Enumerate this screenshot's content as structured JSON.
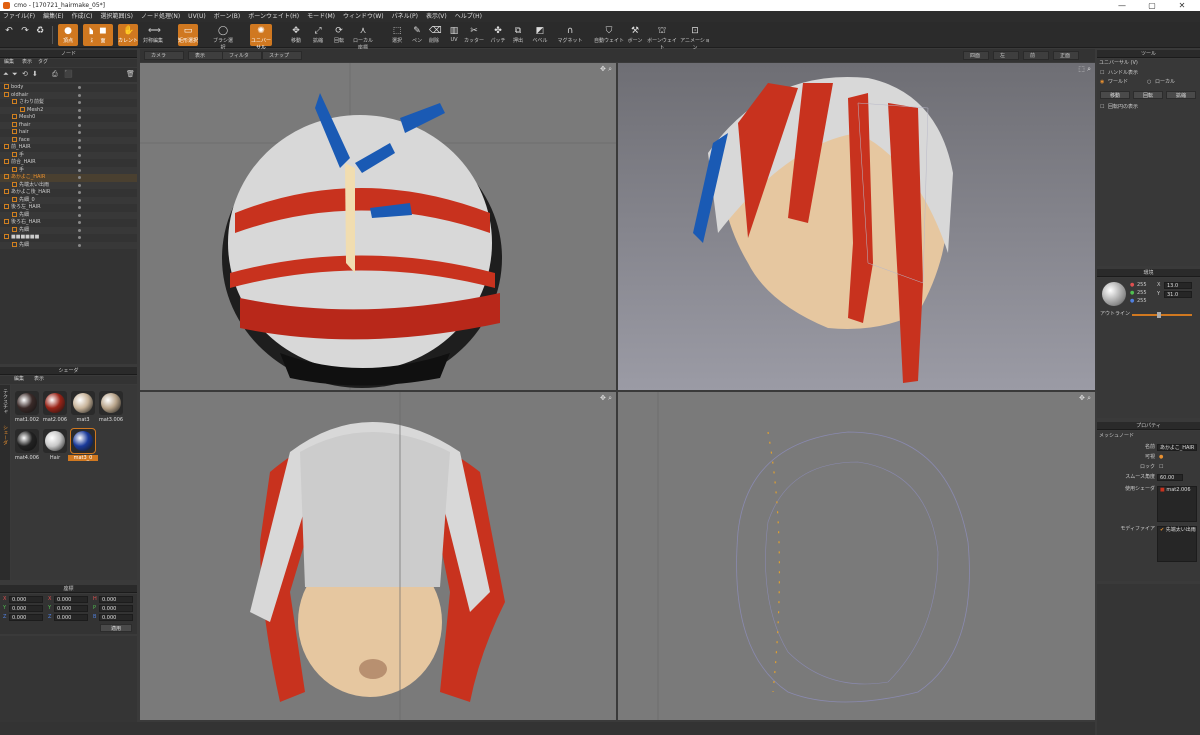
{
  "window": {
    "title": "cmo - [170721_hairmake_05*]",
    "controls": [
      "—",
      "▢",
      "✕"
    ]
  },
  "menu": [
    "ファイル(F)",
    "編集(E)",
    "作成(C)",
    "選択範囲(S)",
    "ノード処理(N)",
    "UV(U)",
    "ボーン(B)",
    "ボーンウェイト(H)",
    "モード(M)",
    "ウィンドウ(W)",
    "パネル(P)",
    "表示(V)",
    "ヘルプ(H)"
  ],
  "toolbar": [
    {
      "label": "頂点",
      "icon": "●",
      "on": true
    },
    {
      "label": "辺",
      "icon": "◣",
      "on": true
    },
    {
      "label": "面",
      "icon": "◼",
      "on": true
    },
    {
      "label": "カレント",
      "icon": "✋",
      "on": true
    },
    {
      "label": "対称編集",
      "icon": "⟺",
      "on": false
    },
    {
      "label": "矩形選択",
      "icon": "▭",
      "on": true
    },
    {
      "label": "ブラシ選択",
      "icon": "◯",
      "on": false
    },
    {
      "label": "ユニバーサル",
      "icon": "✺",
      "on": true
    },
    {
      "label": "移動",
      "icon": "✥",
      "on": false
    },
    {
      "label": "拡縮",
      "icon": "⤢",
      "on": false
    },
    {
      "label": "回転",
      "icon": "⟳",
      "on": false
    },
    {
      "label": "ローカル座標",
      "icon": "⋏",
      "on": false
    },
    {
      "label": "選択",
      "icon": "⬚",
      "on": false
    },
    {
      "label": "ペン",
      "icon": "✎",
      "on": false
    },
    {
      "label": "削除",
      "icon": "⌫",
      "on": false
    },
    {
      "label": "UV",
      "icon": "▥",
      "on": false
    },
    {
      "label": "カッター",
      "icon": "✂",
      "on": false
    },
    {
      "label": "パッチ",
      "icon": "✤",
      "on": false
    },
    {
      "label": "押出",
      "icon": "⧉",
      "on": false
    },
    {
      "label": "ベベル",
      "icon": "◩",
      "on": false
    },
    {
      "label": "マグネット",
      "icon": "∩",
      "on": false
    },
    {
      "label": "自動ウェイト",
      "icon": "⛉",
      "on": false
    },
    {
      "label": "ボーン",
      "icon": "⚒",
      "on": false
    },
    {
      "label": "ボーンウェイト",
      "icon": "⛫",
      "on": false
    },
    {
      "label": "アニメーション",
      "icon": "⊡",
      "on": false
    }
  ],
  "node_panel": {
    "title": "ノード",
    "menu": [
      "編集",
      "表示",
      "タグ"
    ],
    "rows": [
      {
        "name": "body",
        "indent": 0
      },
      {
        "name": "oldhair",
        "indent": 0
      },
      {
        "name": "さわり前髪",
        "indent": 1
      },
      {
        "name": "Mesh2",
        "indent": 2
      },
      {
        "name": "Mesh0",
        "indent": 1
      },
      {
        "name": "fhair",
        "indent": 1
      },
      {
        "name": "hair",
        "indent": 1
      },
      {
        "name": "face",
        "indent": 1
      },
      {
        "name": "前_HAIR",
        "indent": 0
      },
      {
        "name": "手",
        "indent": 1
      },
      {
        "name": "前合_HAIR",
        "indent": 0
      },
      {
        "name": "手",
        "indent": 1
      },
      {
        "name": "あかよこ_HAIR",
        "indent": 0,
        "selected": true
      },
      {
        "name": "先端太い出雨",
        "indent": 1
      },
      {
        "name": "あかよこ後_HAIR",
        "indent": 0
      },
      {
        "name": "先細_0",
        "indent": 1
      },
      {
        "name": "後ろ左_HAIR",
        "indent": 0
      },
      {
        "name": "先細",
        "indent": 1
      },
      {
        "name": "後ろ右_HAIR",
        "indent": 0
      },
      {
        "name": "先細",
        "indent": 1
      },
      {
        "name": "■■■■■■",
        "indent": 0
      },
      {
        "name": "先細",
        "indent": 1
      }
    ]
  },
  "shader_panel": {
    "title": "シェーダ",
    "menu": [
      "編集",
      "表示"
    ],
    "side_tabs": [
      "テクスチャ",
      "シェーダ"
    ],
    "materials": [
      {
        "name": "mat1.002",
        "color": "#3a2a28"
      },
      {
        "name": "mat2.006",
        "color": "#9a2418"
      },
      {
        "name": "mat3",
        "color": "#c8b49a"
      },
      {
        "name": "mat3.006",
        "color": "#b8a48a"
      },
      {
        "name": "mat4.006",
        "color": "#222222"
      },
      {
        "name": "Hair",
        "color": "#c8c8c8"
      },
      {
        "name": "mat3_0",
        "color": "#1a3a9a",
        "selected": true
      }
    ]
  },
  "coord_panel": {
    "title": "座標",
    "fields": [
      [
        "X",
        "0.000",
        "X",
        "0.000",
        "H",
        "0.000"
      ],
      [
        "Y",
        "0.000",
        "Y",
        "0.000",
        "P",
        "0.000"
      ],
      [
        "Z",
        "0.000",
        "Z",
        "0.000",
        "B",
        "0.000"
      ]
    ],
    "apply": "適用"
  },
  "viewport_bar": {
    "left": [
      "カメラ",
      "表示",
      "フィルタ",
      "スナップ"
    ],
    "right": [
      "四面",
      "左",
      "前",
      "正面"
    ]
  },
  "tool_panel": {
    "title": "ツール",
    "mode": "ユニバーサル (V)",
    "handle_label": "ハンドル表示",
    "world": "ワールド",
    "local": "ローカル",
    "buttons": [
      "移動",
      "回転",
      "拡縮"
    ],
    "rotate_check": "回転円の表示"
  },
  "material_panel": {
    "title": "環境",
    "r": "255",
    "g": "255",
    "b": "255",
    "x_label": "X",
    "x_val": "13.0",
    "y_label": "Y",
    "y_val": "31.0",
    "outline": "アウトライン"
  },
  "property_panel": {
    "title": "プロパティ",
    "section": "メッシュノード",
    "name_label": "名前",
    "name_val": "あかよこ_HAIR",
    "visible_label": "可視",
    "lock_label": "ロック",
    "smooth_label": "スムース角度",
    "smooth_val": "60.00",
    "shader_label": "使用シェーダ",
    "shader_val": "mat2.006",
    "modifier_label": "モディファイア",
    "modifier_val": "先端太い出雨"
  },
  "colors": {
    "accent": "#d07820",
    "hair_red": "#c8321e",
    "hair_blue": "#1a5ab4",
    "skin": "#e6c7a0"
  }
}
